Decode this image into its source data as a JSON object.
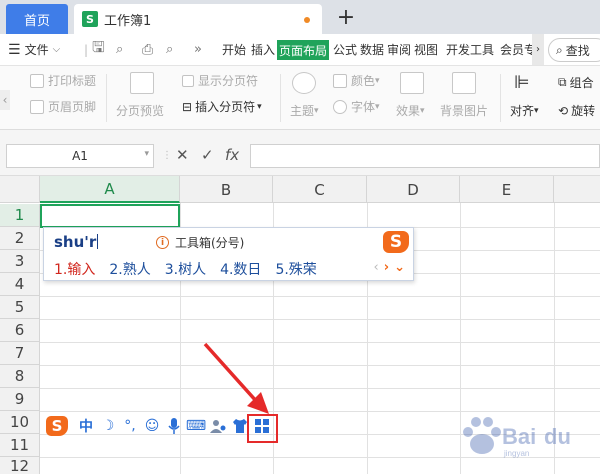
{
  "tabs": {
    "home": "首页",
    "document": "工作簿1",
    "new_tab": "+"
  },
  "menu": {
    "file": "文件",
    "items": [
      "开始",
      "插入",
      "页面布局",
      "公式",
      "数据",
      "审阅",
      "视图",
      "开发工具",
      "会员专"
    ],
    "active_index": 2,
    "search": "查找"
  },
  "ribbon": {
    "print_titles": "打印标题",
    "header_footer": "页眉页脚",
    "page_break_preview": "分页预览",
    "show_page_breaks": "显示分页符",
    "insert_page_break": "插入分页符",
    "theme": "主题",
    "colors": "颜色",
    "fonts": "字体",
    "effects": "效果",
    "background": "背景图片",
    "align": "对齐",
    "group": "组合",
    "rotate": "旋转"
  },
  "formula_bar": {
    "cell_ref": "A1",
    "cancel": "✕",
    "confirm": "✓",
    "fx": "fx",
    "value": ""
  },
  "grid": {
    "columns": [
      "A",
      "B",
      "C",
      "D",
      "E"
    ],
    "rows": [
      "1",
      "2",
      "3",
      "4",
      "5",
      "6",
      "7",
      "8",
      "9",
      "10",
      "11",
      "12"
    ],
    "selected_column": "A",
    "selected_row": "1"
  },
  "ime": {
    "composition": "shu'r",
    "hint": "工具箱(分号)",
    "candidates": [
      "1.输入",
      "2.熟人",
      "3.树人",
      "4.数日",
      "5.殊荣"
    ],
    "logo": "S",
    "toolbar": {
      "lang": "中",
      "punct": "°,",
      "icons": [
        "sogou-logo-icon",
        "lang-zh-icon",
        "half-width-moon-icon",
        "punctuation-icon",
        "emoji-smile-icon",
        "microphone-icon",
        "keyboard-icon",
        "user-icon",
        "skin-shirt-icon",
        "toolbox-grid-icon"
      ]
    }
  },
  "colors": {
    "accent_green": "#1fa35a",
    "tab_blue": "#3f7de8",
    "ime_orange": "#f26a1b",
    "highlight_red": "#e52a2a"
  }
}
